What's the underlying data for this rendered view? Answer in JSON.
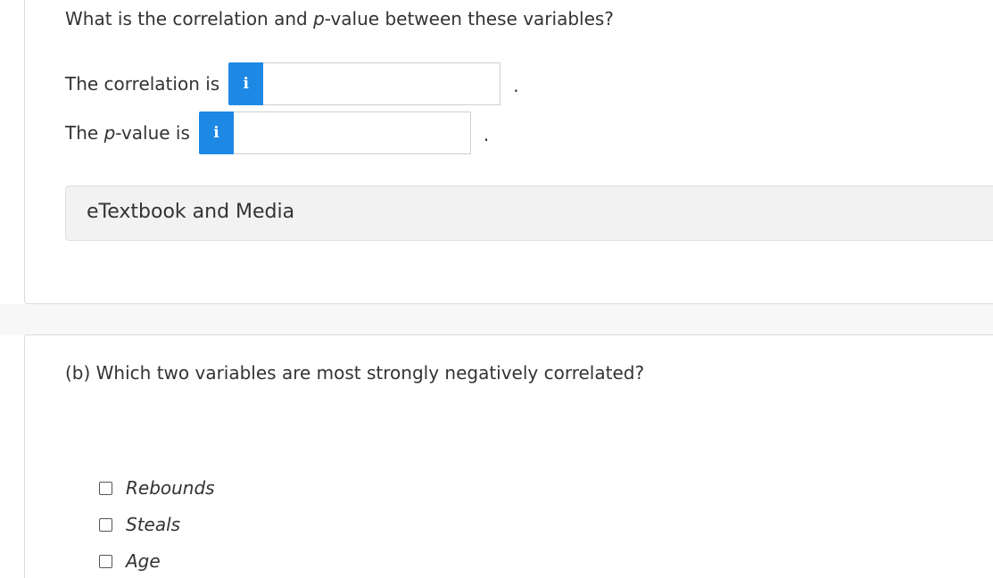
{
  "question_a": {
    "prefix": "What is the correlation and ",
    "italic_p": "p",
    "suffix": "-value between these variables?"
  },
  "correlation_row": {
    "label": "The correlation is",
    "info_glyph": "i",
    "input_value": "",
    "trailing": "."
  },
  "pvalue_row": {
    "label_prefix": "The ",
    "label_italic": "p",
    "label_suffix": "-value is",
    "info_glyph": "i",
    "input_value": "",
    "trailing": "."
  },
  "media": {
    "label": "eTextbook and Media"
  },
  "question_b": {
    "text": "(b) Which two variables are most strongly negatively correlated?"
  },
  "options": [
    {
      "label": "Rebounds",
      "checked": false
    },
    {
      "label": "Steals",
      "checked": false
    },
    {
      "label": "Age",
      "checked": false
    }
  ],
  "colors": {
    "info_button": "#1e88e5",
    "text": "#333333",
    "media_bg": "#f2f2f2"
  },
  "icons": {
    "info": "info-icon",
    "checkbox": "checkbox-icon"
  }
}
